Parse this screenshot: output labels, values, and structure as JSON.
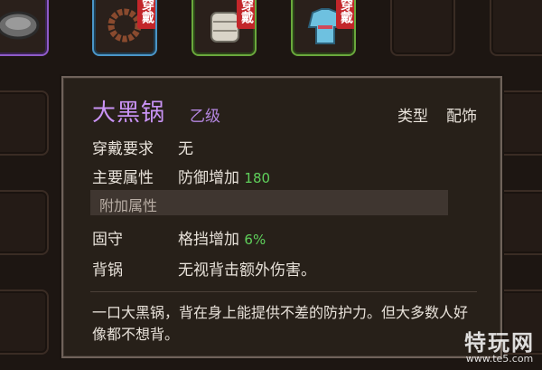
{
  "inventory": {
    "equip_badge": "穿戴"
  },
  "tooltip": {
    "name": "大黑锅",
    "grade": "乙级",
    "type_label": "类型",
    "type_value": "配饰",
    "rows": [
      {
        "label": "穿戴要求",
        "value": "无"
      },
      {
        "label": "主要属性",
        "value": "防御增加",
        "num": "180"
      }
    ],
    "section_title": "附加属性",
    "extra_rows": [
      {
        "label": "固守",
        "value": "格挡增加",
        "num": "6%"
      },
      {
        "label": "背锅",
        "value": "无视背击额外伤害。"
      }
    ],
    "description": "一口大黑锅，背在身上能提供不差的防护力。但大多数人好像都不想背。"
  },
  "watermark": {
    "title": "特玩网",
    "url": "www.te5.com"
  },
  "colors": {
    "name_purple": "#c993f5",
    "value_green": "#5fd05b",
    "equip_red": "#c2262a"
  }
}
